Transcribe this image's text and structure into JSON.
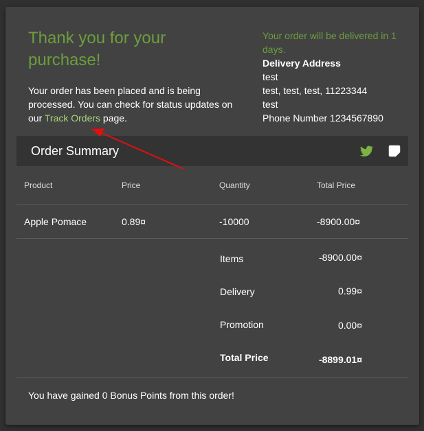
{
  "confirmation": {
    "title": "Thank you for your purchase!",
    "message_before": "Your order has been placed and is being processed. You can check for status updates on our ",
    "track_link": "Track Orders",
    "message_after": " page."
  },
  "delivery": {
    "eta": "Your order will be delivered in 1 days.",
    "heading": "Delivery Address",
    "name": "test",
    "address": "test, test, test, 11223344",
    "country": "test",
    "phone": "Phone Number 1234567890"
  },
  "summary": {
    "title": "Order Summary",
    "icons": [
      "twitter-icon",
      "share-icon"
    ],
    "columns": [
      "Product",
      "Price",
      "Quantity",
      "Total Price"
    ],
    "rows": [
      {
        "product": "Apple Pomace",
        "price": "0.89¤",
        "quantity": "-10000",
        "total": "-8900.00¤"
      }
    ],
    "totals": {
      "items_label": "Items",
      "items_value": "-8900.00¤",
      "delivery_label": "Delivery",
      "delivery_value": "0.99¤",
      "promotion_label": "Promotion",
      "promotion_value": "0.00¤",
      "total_label": "Total Price",
      "total_value": "-8899.01¤"
    }
  },
  "bonus": "You have gained 0 Bonus Points from this order!",
  "colors": {
    "accent_green": "#6c9e3c",
    "link_green": "#a5d67a",
    "annotation_red": "#e01010"
  }
}
